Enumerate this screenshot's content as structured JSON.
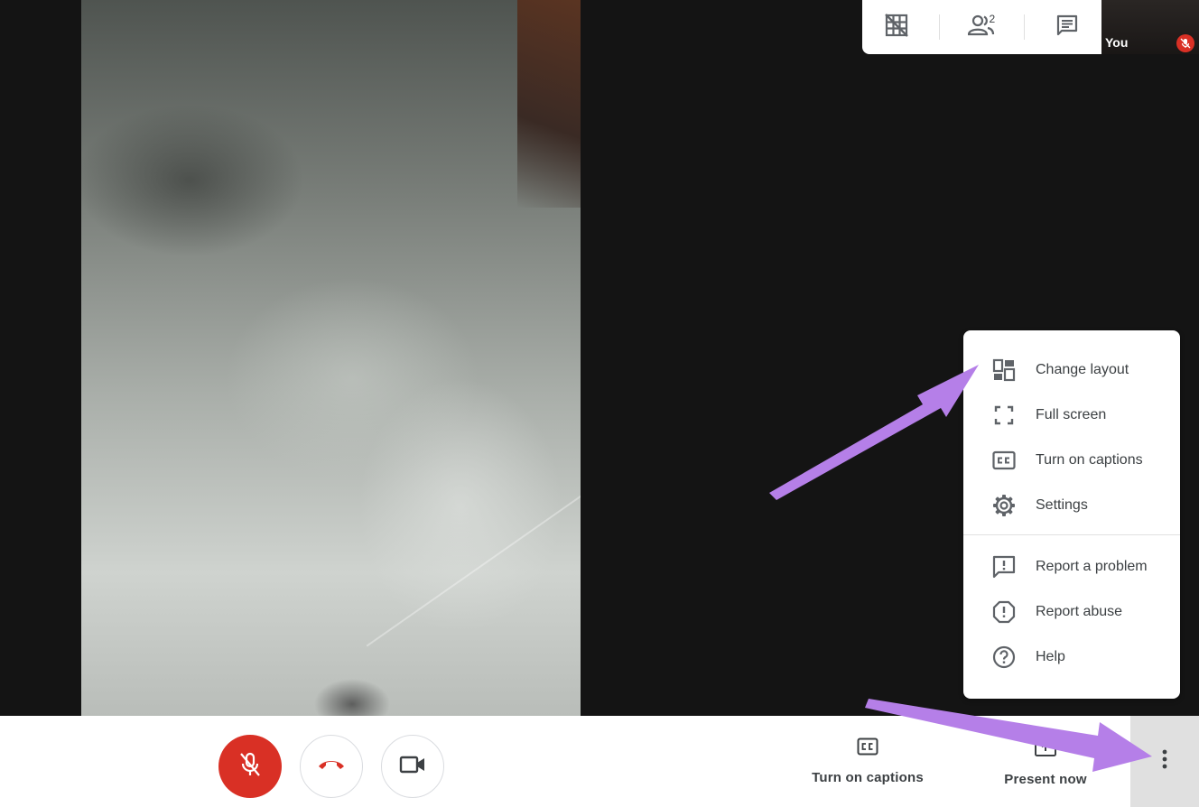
{
  "top_bar": {
    "tiles_icon": "grid-off-icon",
    "participants_icon": "people-icon",
    "participants_count": "2",
    "chat_icon": "chat-icon"
  },
  "self_view": {
    "label": "You",
    "mic_state_icon": "mic-off-icon"
  },
  "menu": {
    "items": [
      {
        "label": "Change layout",
        "icon": "layout-icon"
      },
      {
        "label": "Full screen",
        "icon": "fullscreen-icon"
      },
      {
        "label": "Turn on captions",
        "icon": "closed-captions-icon"
      },
      {
        "label": "Settings",
        "icon": "gear-icon"
      },
      {
        "label": "Report a problem",
        "icon": "feedback-icon"
      },
      {
        "label": "Report abuse",
        "icon": "alert-octagon-icon"
      },
      {
        "label": "Help",
        "icon": "help-circle-icon"
      }
    ]
  },
  "bottom_bar": {
    "mic_icon": "mic-off-icon",
    "end_call_icon": "hang-up-icon",
    "camera_icon": "videocam-icon",
    "captions_label": "Turn on captions",
    "present_label": "Present now",
    "more_icon": "more-vert-icon"
  },
  "colors": {
    "danger": "#d93025",
    "annotation_arrow": "#b57fe8",
    "text": "#3c4043"
  }
}
